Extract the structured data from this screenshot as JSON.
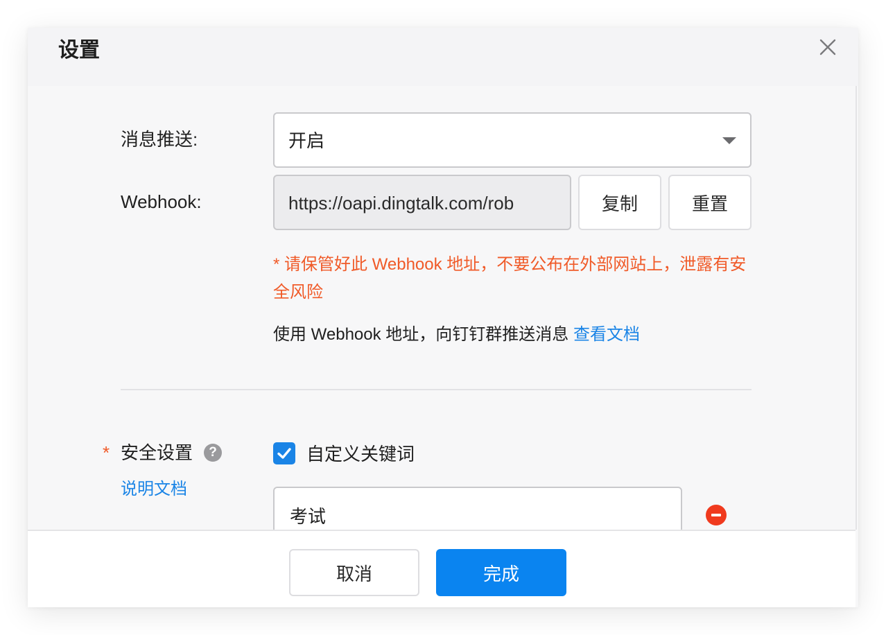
{
  "dialog": {
    "title": "设置"
  },
  "push": {
    "label": "消息推送:",
    "selected": "开启"
  },
  "webhook": {
    "label": "Webhook:",
    "value": "https://oapi.dingtalk.com/rob",
    "copy_label": "复制",
    "reset_label": "重置",
    "warning": "* 请保管好此 Webhook 地址，不要公布在外部网站上，泄露有安全风险",
    "info_text": "使用 Webhook 地址，向钉钉群推送消息",
    "doc_link": "查看文档"
  },
  "security": {
    "required_mark": "*",
    "label": "安全设置",
    "help_glyph": "?",
    "doc_link": "说明文档",
    "keyword_checkbox_label": "自定义关键词",
    "keyword_checked": true,
    "keyword_value": "考试"
  },
  "footer": {
    "cancel_label": "取消",
    "done_label": "完成"
  },
  "colors": {
    "accent": "#0a84f0",
    "link": "#1a84e6",
    "warning": "#f05a28",
    "danger": "#f03a1e"
  }
}
